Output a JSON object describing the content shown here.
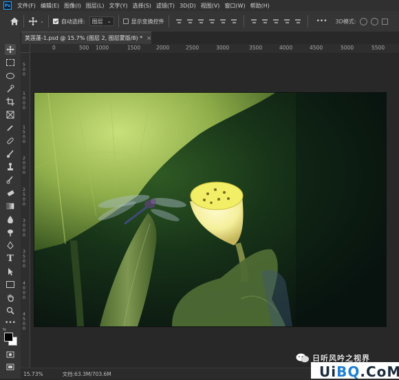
{
  "menubar": {
    "logo": "Ps",
    "items": [
      "文件(F)",
      "编辑(E)",
      "图像(I)",
      "图层(L)",
      "文字(Y)",
      "选择(S)",
      "滤镜(T)",
      "3D(D)",
      "视图(V)",
      "窗口(W)",
      "帮助(H)"
    ]
  },
  "options": {
    "auto_select_label": "自动选择:",
    "auto_select_checked": true,
    "layer_dropdown_value": "图层",
    "show_transform_label": "显示变换控件",
    "show_transform_checked": false,
    "more": "•••"
  },
  "document": {
    "tab_title": "荚莲蓬-1.psd @ 15.7% (图层 2, 图层蒙版/8) *",
    "close_symbol": "×"
  },
  "ruler": {
    "top_labels": [
      "0",
      "500",
      "1000",
      "1500",
      "2000",
      "2500",
      "3000",
      "3500",
      "4000",
      "4500",
      "5000",
      "5500"
    ],
    "left_labels": [
      "5\n0\n0",
      "1\n0\n0\n0",
      "1\n5\n0\n0",
      "2\n0\n0\n0",
      "2\n5\n0\n0",
      "3\n0\n0\n0",
      "3\n5\n0\n0",
      "4\n0\n0\n0",
      "4\n5\n0\n0"
    ]
  },
  "status": {
    "zoom": "15.73%",
    "doc_size": "文档:63.3M/703.6M"
  },
  "watermark": {
    "text": "日听风吟之视界"
  },
  "site_badge": {
    "text_a": "Ui",
    "text_b": "BQ",
    "text_c": ".CoM"
  },
  "colors": {
    "foreground": "#000000",
    "background": "#ffffff",
    "accent": "#31a8ff"
  }
}
